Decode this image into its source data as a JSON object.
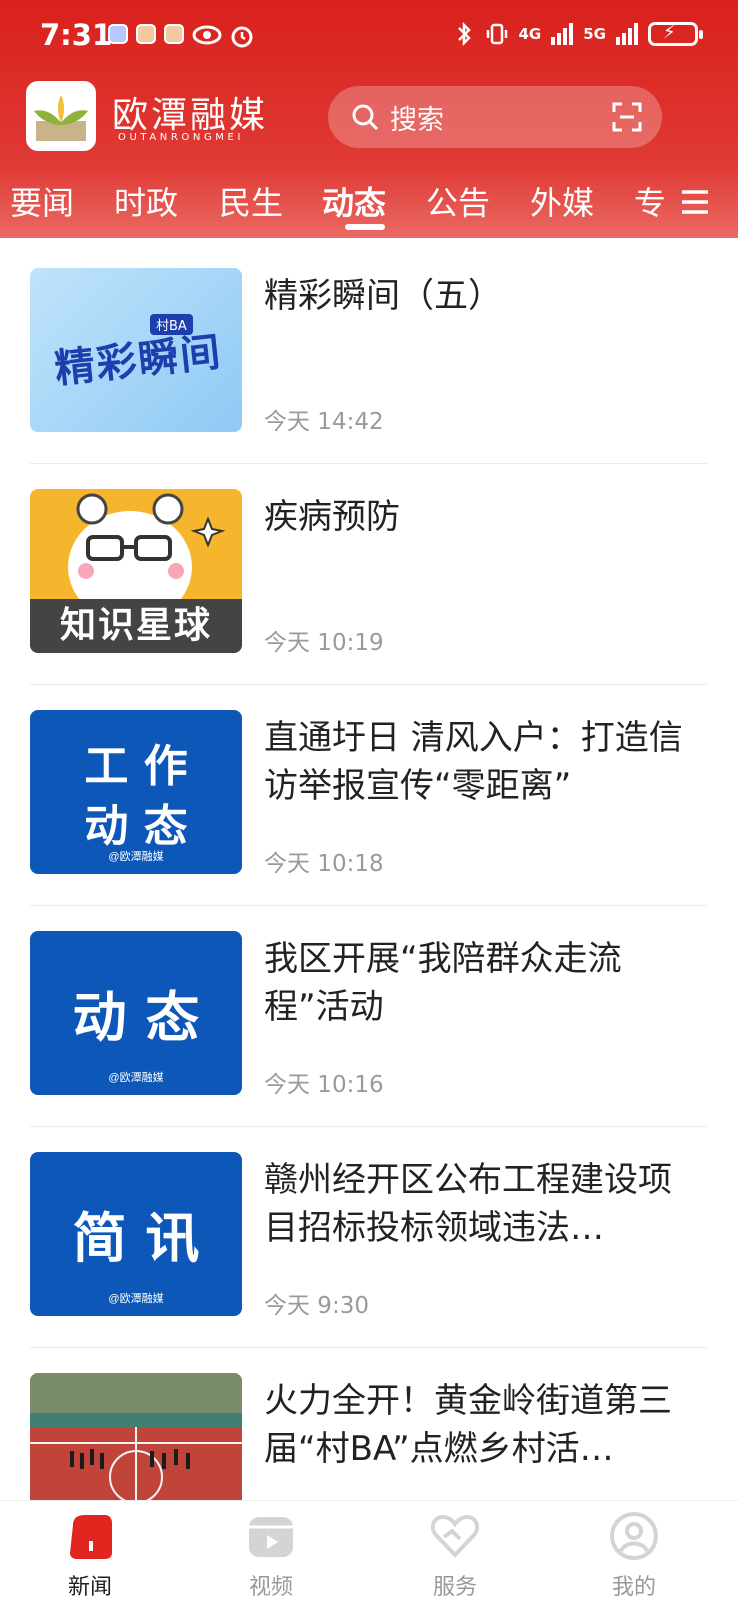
{
  "status_bar": {
    "time": "7:31",
    "network_1": "4G",
    "network_2": "5G"
  },
  "brand": {
    "name": "欧潭融媒",
    "subtitle": "OUTANRONGMEI"
  },
  "search": {
    "placeholder": "搜索"
  },
  "tabs": [
    {
      "label": "要闻"
    },
    {
      "label": "时政"
    },
    {
      "label": "民生"
    },
    {
      "label": "动态",
      "active": true
    },
    {
      "label": "公告"
    },
    {
      "label": "外媒"
    },
    {
      "label": "专"
    }
  ],
  "articles": [
    {
      "title": "精彩瞬间（五）",
      "time": "今天 14:42",
      "thumb_text": "精彩瞬间",
      "thumb_tag": "村BA"
    },
    {
      "title": "疾病预防",
      "time": "今天 10:19",
      "thumb_text": "知识星球"
    },
    {
      "title": "直通圩日 清风入户：打造信访举报宣传“零距离”",
      "time": "今天 10:18",
      "thumb_text_1": "工 作",
      "thumb_text_2": "动 态",
      "watermark": "@欧潭融媒"
    },
    {
      "title": "我区开展“我陪群众走流程”活动",
      "time": "今天 10:16",
      "thumb_text": "动 态",
      "watermark": "@欧潭融媒"
    },
    {
      "title": "赣州经开区公布工程建设项目招标投标领域违法…",
      "time": "今天 9:30",
      "thumb_text": "简 讯",
      "watermark": "@欧潭融媒"
    },
    {
      "title": "火力全开！黄金岭街道第三届“村BA”点燃乡村活…",
      "time": ""
    }
  ],
  "bottom_nav": [
    {
      "label": "新闻",
      "icon": "news-icon",
      "active": true
    },
    {
      "label": "视频",
      "icon": "video-icon"
    },
    {
      "label": "服务",
      "icon": "service-icon"
    },
    {
      "label": "我的",
      "icon": "profile-icon"
    }
  ],
  "colors": {
    "brand_red": "#d9201c",
    "tile_blue": "#0d57b8"
  }
}
